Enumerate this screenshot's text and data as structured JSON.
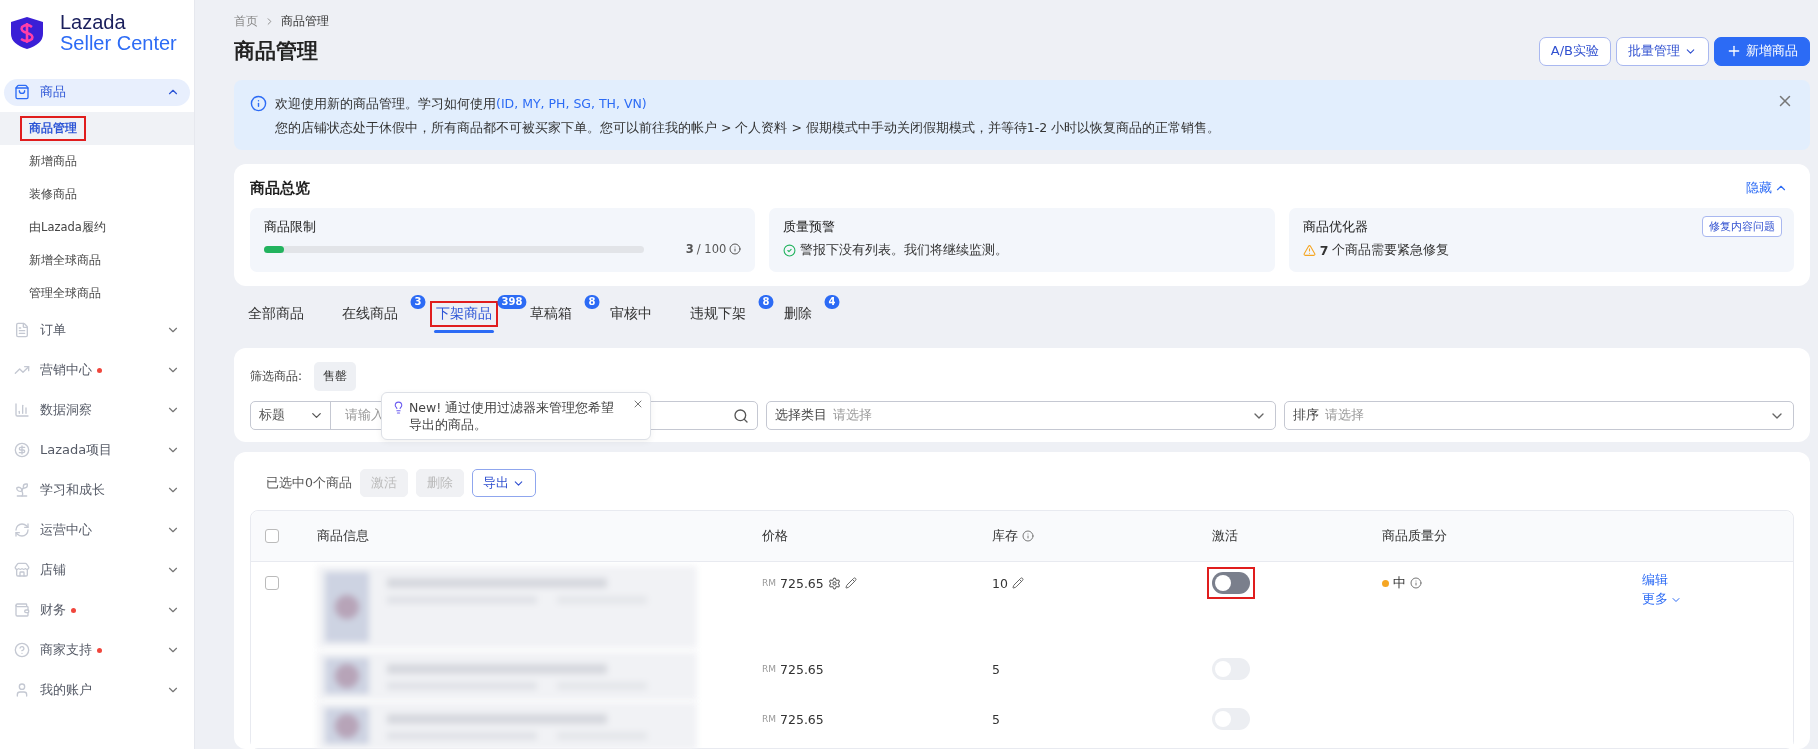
{
  "logo": {
    "line1": "Lazada",
    "line2": "Seller Center"
  },
  "sidebar": {
    "items": [
      {
        "label": "商品",
        "expanded": true,
        "dot": false,
        "children": [
          {
            "label": "商品管理",
            "selected": true,
            "highlighted": true
          },
          {
            "label": "新增商品",
            "selected": false,
            "highlighted": false
          },
          {
            "label": "装修商品",
            "selected": false,
            "highlighted": false
          },
          {
            "label": "由Lazada履约",
            "selected": false,
            "highlighted": false
          },
          {
            "label": "新增全球商品",
            "selected": false,
            "highlighted": false
          },
          {
            "label": "管理全球商品",
            "selected": false,
            "highlighted": false
          }
        ]
      },
      {
        "label": "订单",
        "expanded": false,
        "dot": false
      },
      {
        "label": "营销中心",
        "expanded": false,
        "dot": true
      },
      {
        "label": "数据洞察",
        "expanded": false,
        "dot": false
      },
      {
        "label": "Lazada项目",
        "expanded": false,
        "dot": false
      },
      {
        "label": "学习和成长",
        "expanded": false,
        "dot": false
      },
      {
        "label": "运营中心",
        "expanded": false,
        "dot": false
      },
      {
        "label": "店铺",
        "expanded": false,
        "dot": false
      },
      {
        "label": "财务",
        "expanded": false,
        "dot": true
      },
      {
        "label": "商家支持",
        "expanded": false,
        "dot": true
      },
      {
        "label": "我的账户",
        "expanded": false,
        "dot": false
      }
    ]
  },
  "breadcrumb": [
    "首页",
    "商品管理"
  ],
  "page_title": "商品管理",
  "header_buttons": [
    {
      "label": "A/B实验",
      "kind": "outline"
    },
    {
      "label": "批量管理",
      "kind": "dropdown"
    },
    {
      "label": "新增商品",
      "kind": "primary"
    }
  ],
  "notice": {
    "line1": "欢迎使用新的商品管理。学习如何使用",
    "links": "(ID, MY, PH, SG, TH, VN)",
    "line2": "您的店铺状态处于休假中，所有商品都不可被买家下单。您可以前往我的帐户 > 个人资料 > 假期模式中手动关闭假期模式，并等待1-2 小时以恢复商品的正常销售。"
  },
  "overview": {
    "title": "商品总览",
    "toggle": "隐藏",
    "cards": [
      {
        "kind": "limit",
        "title": "商品限制",
        "level": 0.03,
        "count": "3",
        "total": "/ 100"
      },
      {
        "kind": "ok",
        "title": "质量预警",
        "message": "警报下没有列表。我们将继续监测。"
      },
      {
        "kind": "warning",
        "title": "商品优化器",
        "count": "7",
        "message": "个商品需要紧急修复",
        "button": "修复内容问题"
      }
    ]
  },
  "tabs": [
    {
      "label": "全部商品",
      "selected": false,
      "highlighted": false
    },
    {
      "label": "在线商品",
      "count": "3",
      "selected": false,
      "highlighted": false
    },
    {
      "label": "下架商品",
      "count": "398",
      "selected": true,
      "highlighted": true
    },
    {
      "label": "草稿箱",
      "count": "8",
      "selected": false,
      "highlighted": false
    },
    {
      "label": "审核中",
      "selected": false,
      "highlighted": false
    },
    {
      "label": "违规下架",
      "count": "8",
      "selected": false,
      "highlighted": false
    },
    {
      "label": "删除",
      "count": "4",
      "selected": false,
      "highlighted": false
    }
  ],
  "filter": {
    "label": "筛选商品:",
    "chips": [
      "售罄"
    ],
    "search_type": "标题",
    "search_placeholder": "请输入",
    "category_label": "选择类目",
    "category_placeholder": "请选择",
    "sort_label": "排序",
    "sort_placeholder": "请选择"
  },
  "tooltip": {
    "badge": "New!",
    "text": "通过使用过滤器来管理您希望导出的商品。"
  },
  "bulk": {
    "selected_text": "已选中0个商品",
    "buttons": [
      {
        "label": "激活",
        "disabled": true
      },
      {
        "label": "删除",
        "disabled": true
      },
      {
        "label": "导出",
        "disabled": false
      }
    ]
  },
  "table": {
    "all_checked": false,
    "columns": [
      "商品信息",
      "价格",
      "库存",
      "激活",
      "商品质量分"
    ],
    "rows": [
      {
        "checked": false,
        "currency": "RM",
        "price": "725.65",
        "stock": "10",
        "editable": true,
        "active": false,
        "hovered": true,
        "highlighted": true,
        "quality": "中",
        "color": "#f5a623",
        "actions": [
          "编辑",
          "更多"
        ]
      },
      {
        "currency": "RM",
        "price": "725.65",
        "stock": "5",
        "editable": false,
        "active": false,
        "hovered": false,
        "highlighted": false
      },
      {
        "currency": "RM",
        "price": "725.65",
        "stock": "5",
        "editable": false,
        "active": false,
        "hovered": false,
        "highlighted": false
      }
    ]
  }
}
